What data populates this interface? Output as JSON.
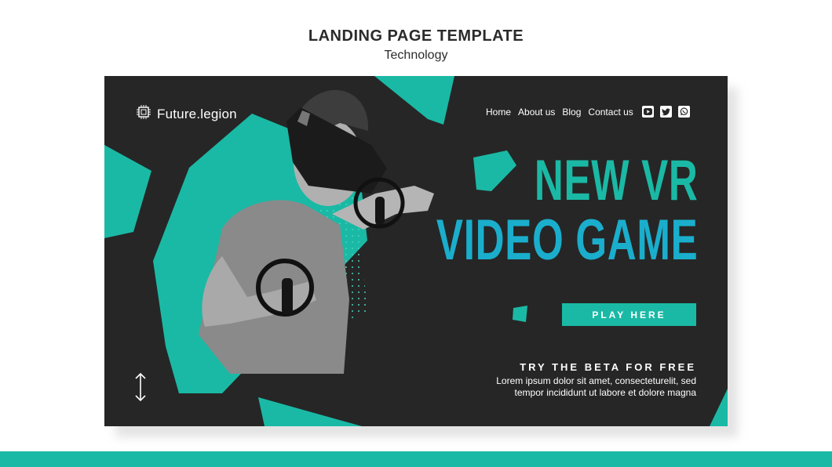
{
  "page_header": {
    "title": "LANDING PAGE TEMPLATE",
    "subtitle": "Technology"
  },
  "landing": {
    "logo": {
      "text": "Future.legion",
      "icon": "chip-icon"
    },
    "nav": {
      "links": [
        "Home",
        "About us",
        "Blog",
        "Contact us"
      ],
      "socials": [
        "youtube-icon",
        "twitter-icon",
        "whatsapp-icon"
      ]
    },
    "hero": {
      "line1": "NEW VR",
      "line2": "VIDEO GAME",
      "cta_label": "PLAY HERE"
    },
    "beta": {
      "title": "TRY THE BETA FOR FREE",
      "body_line1": "Lorem ipsum dolor sit amet, consecteturelit, sed",
      "body_line2": "tempor incididunt ut labore et dolore magna"
    },
    "scroll_icon": "vertical-arrows-icon",
    "colors": {
      "accent": "#1ab9a5",
      "accent_blue": "#1aaecc",
      "background": "#262626"
    }
  }
}
